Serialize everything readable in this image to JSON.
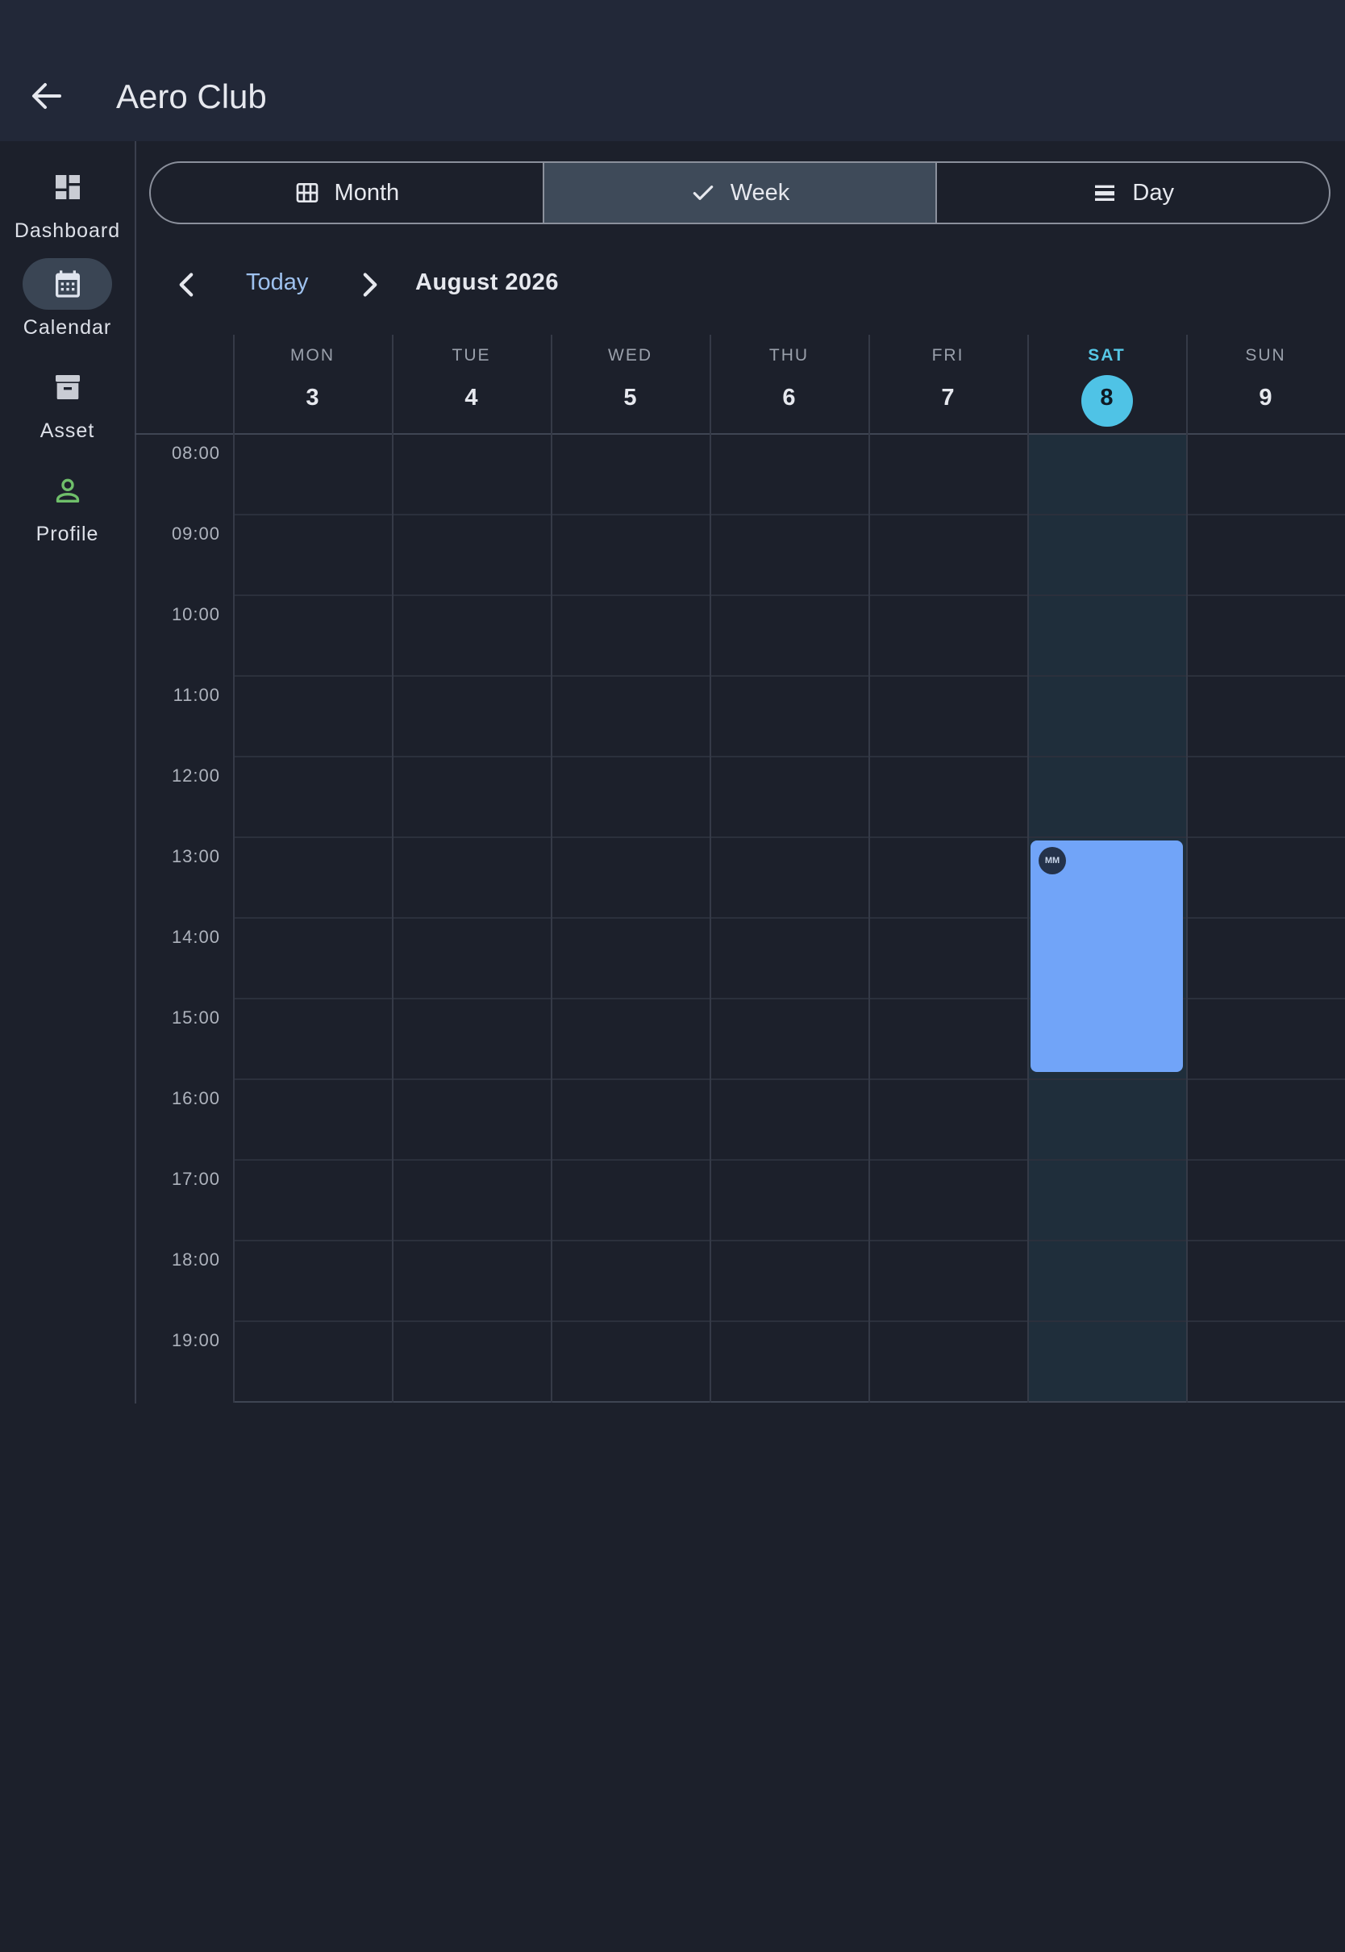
{
  "app": {
    "title": "Aero Club"
  },
  "nav": {
    "items": [
      {
        "label": "Dashboard",
        "icon": "dashboard-icon"
      },
      {
        "label": "Calendar",
        "icon": "calendar-icon",
        "active": true
      },
      {
        "label": "Asset",
        "icon": "archive-icon"
      },
      {
        "label": "Profile",
        "icon": "person-icon"
      }
    ]
  },
  "view_toggle": {
    "options": [
      {
        "label": "Month",
        "icon": "grid-icon"
      },
      {
        "label": "Week",
        "icon": "check-icon",
        "selected": true
      },
      {
        "label": "Day",
        "icon": "list-icon"
      }
    ]
  },
  "date_nav": {
    "today_label": "Today",
    "period_title": "August 2026"
  },
  "week": {
    "days": [
      {
        "dow": "MON",
        "date": "3"
      },
      {
        "dow": "TUE",
        "date": "4"
      },
      {
        "dow": "WED",
        "date": "5"
      },
      {
        "dow": "THU",
        "date": "6"
      },
      {
        "dow": "FRI",
        "date": "7"
      },
      {
        "dow": "SAT",
        "date": "8",
        "today": true
      },
      {
        "dow": "SUN",
        "date": "9"
      }
    ],
    "hours": [
      "08:00",
      "09:00",
      "10:00",
      "11:00",
      "12:00",
      "13:00",
      "14:00",
      "15:00",
      "16:00",
      "17:00",
      "18:00",
      "19:00"
    ]
  },
  "events": [
    {
      "day": "SAT",
      "start": "13:00",
      "end": "15:55",
      "avatar": "MM",
      "color": "#71a4f8"
    }
  ],
  "colors": {
    "background": "#1c202b",
    "today_accent": "#4fc3e6",
    "link": "#9ec1ee",
    "profile_icon": "#6fbf6a"
  }
}
